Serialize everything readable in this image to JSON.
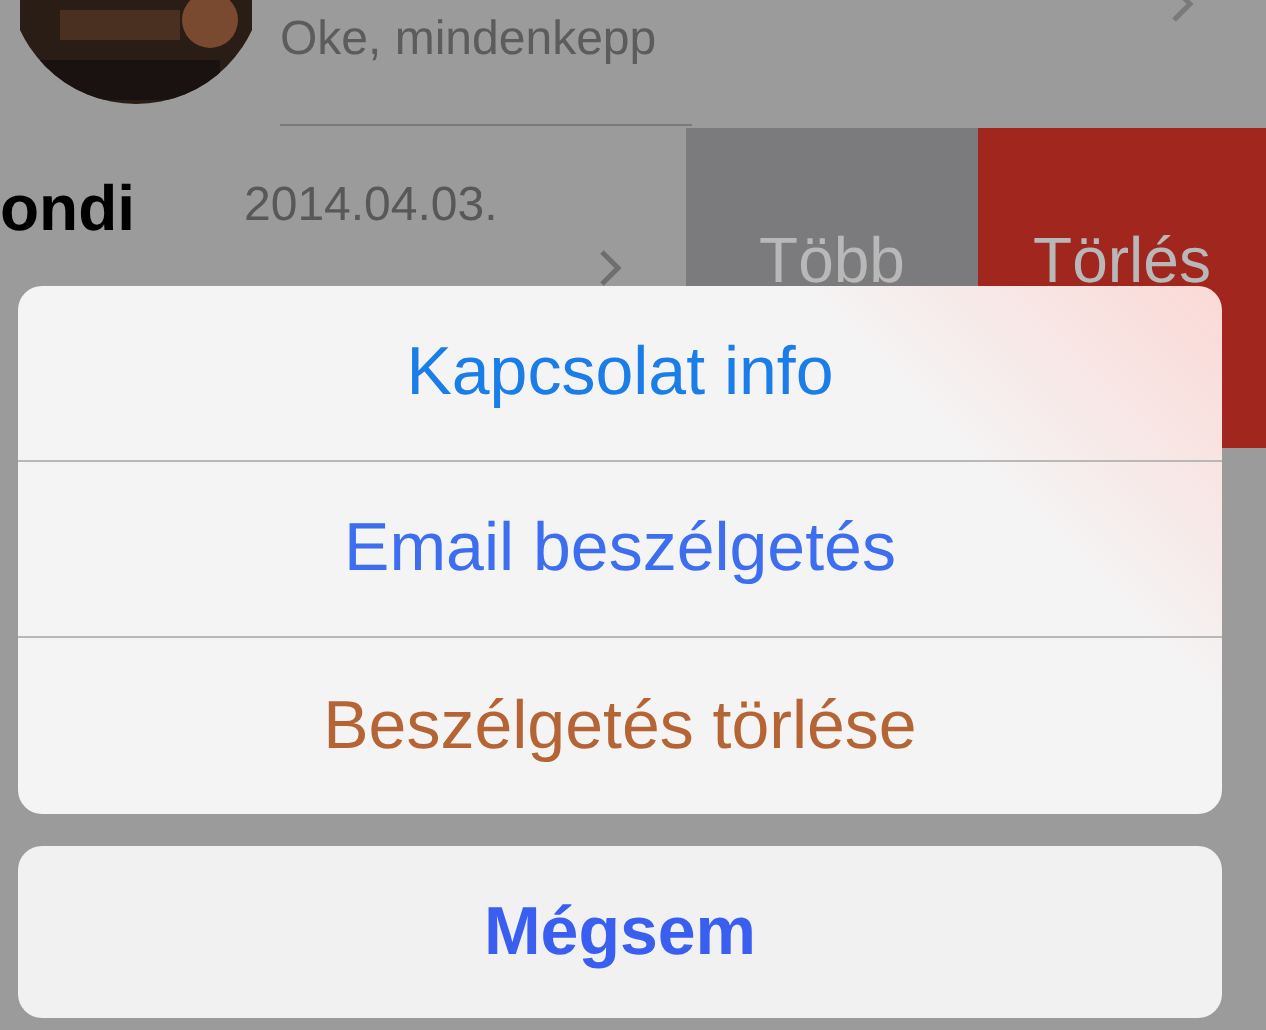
{
  "conversations": {
    "first_row": {
      "preview": "Oke, mindenkepp"
    },
    "swiped_row": {
      "name": "ondi",
      "date": "2014.04.03.",
      "actions": [
        {
          "label": "Több",
          "kind": "more"
        },
        {
          "label": "Törlés",
          "kind": "delete"
        }
      ]
    }
  },
  "action_sheet": {
    "options": [
      {
        "label": "Kapcsolat info",
        "kind": "primary"
      },
      {
        "label": "Email beszélgetés",
        "kind": "default"
      },
      {
        "label": "Beszélgetés törlése",
        "kind": "destructive"
      }
    ],
    "cancel": "Mégsem"
  }
}
